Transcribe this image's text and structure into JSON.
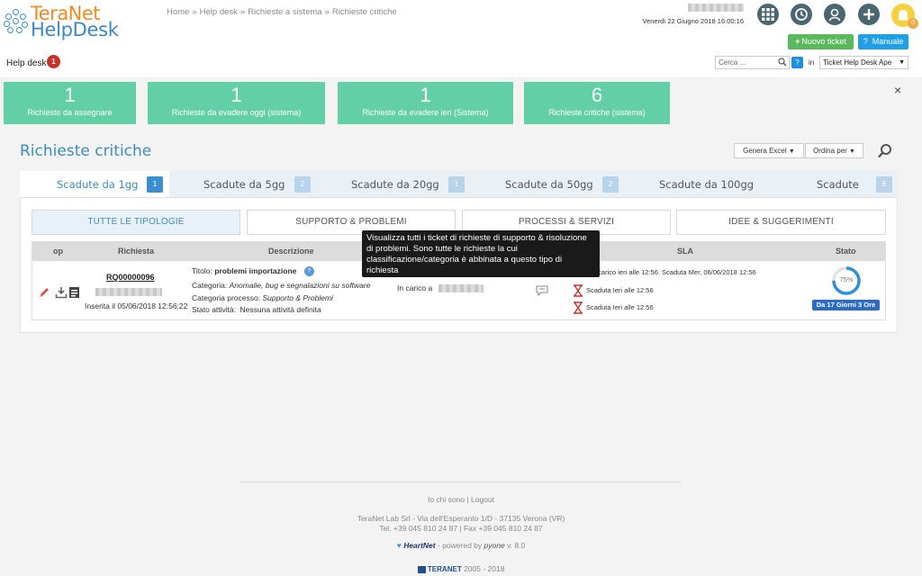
{
  "brand": {
    "line1": "TeraNet",
    "line2": "HelpDesk"
  },
  "breadcrumb": [
    "Home",
    "Help desk",
    "Richieste a sistema",
    "Richieste critiche"
  ],
  "breadcrumb_sep": "»",
  "user": {
    "datetime": "Venerdì 22 Giugno 2018 16:00:16"
  },
  "header_icons": [
    "apps-grid-icon",
    "history-icon",
    "user-icon",
    "add-icon",
    "bell-icon"
  ],
  "notifications_count": "0",
  "actions": {
    "new_ticket": "Nuovo ticket",
    "manual": "Manuale",
    "new_icon": "+",
    "manual_icon": "?"
  },
  "nav": {
    "helpdesk_label": "Help desk",
    "helpdesk_count": "1"
  },
  "search": {
    "placeholder": "Cerca ...",
    "help": "?",
    "in_label": "in",
    "scope": "Ticket Help Desk Ape"
  },
  "tiles": [
    {
      "value": "1",
      "label": "Richieste da assegnare"
    },
    {
      "value": "1",
      "label": "Richieste da evadere oggi (sistema)"
    },
    {
      "value": "1",
      "label": "Richieste da evadere ieri (Sistema)"
    },
    {
      "value": "6",
      "label": "Richieste critiche (sistema)"
    }
  ],
  "close_symbol": "×",
  "section": {
    "title": "Richieste critiche",
    "excel": "Genera Excel",
    "order": "Ordina per"
  },
  "tabs": [
    {
      "label": "Scadute da 1gg",
      "count": "1"
    },
    {
      "label": "Scadute da 5gg",
      "count": "2"
    },
    {
      "label": "Scadute da 20gg",
      "count": "1"
    },
    {
      "label": "Scadute da 50gg",
      "count": "2"
    },
    {
      "label": "Scadute da 100gg",
      "count": ""
    },
    {
      "label": "Scadute",
      "count": "6"
    }
  ],
  "filters": [
    "TUTTE LE TIPOLOGIE",
    "SUPPORTO & PROBLEMI",
    "PROCESSI & SERVIZI",
    "IDEE & SUGGERIMENTI"
  ],
  "table": {
    "headers": {
      "op": "op",
      "richiesta": "Richiesta",
      "descrizione": "Descrizione",
      "sla": "SLA",
      "stato": "Stato"
    }
  },
  "ticket": {
    "code": "RQ00000096",
    "inserted": "Inserita il 05/06/2018 12:56:22",
    "title_label": "Titolo:",
    "title": "problemi importazione",
    "category_label": "Categoria:",
    "category": "Anomalie, bug e segnalazioni su software",
    "process_label": "Categoria processo:",
    "process": "Supporto & Problemi",
    "activity_label": "Stato attività:",
    "activity": "Nessuna attività definita",
    "assigned_label": "In carico a",
    "sla_1": "a in carico ieri alle 12:56. Scaduta Mer, 06/06/2018 12:56",
    "sla_2": "Scaduta Ieri alle 12:56",
    "sla_3": "Scaduta Ieri alle 12:56",
    "progress_label": "75%",
    "progress": 0.75,
    "status_badge": "Da 17 Giorni 3 Ore"
  },
  "tooltip": "Visualizza tutti i ticket di richieste di supporto & risoluzione di problemi. Sono tutte le richieste la cui classificazione/categoria è abbinata a questo tipo di richiesta",
  "footer": {
    "link_me": "Io chi sono",
    "separator": "|",
    "link_logout": "Logout",
    "address": "TeraNet Lab Srl - Via dell'Esperanto 1/D - 37135 Verona (VR)",
    "phone": "Tel. +39 045 810 24 87 | Fax +39 045 810 24 87",
    "heartnet": "HeartNet",
    "powered": "- powered by",
    "pyone": "pyone",
    "version": "v. 8.0",
    "teranet": "TERANET",
    "years": "2005 - 2018"
  },
  "colors": {
    "accent": "#3c8dbc",
    "tile": "#62cfa7",
    "success": "#5cb85c",
    "info": "#1e9fe6",
    "danger": "#c9302c"
  }
}
